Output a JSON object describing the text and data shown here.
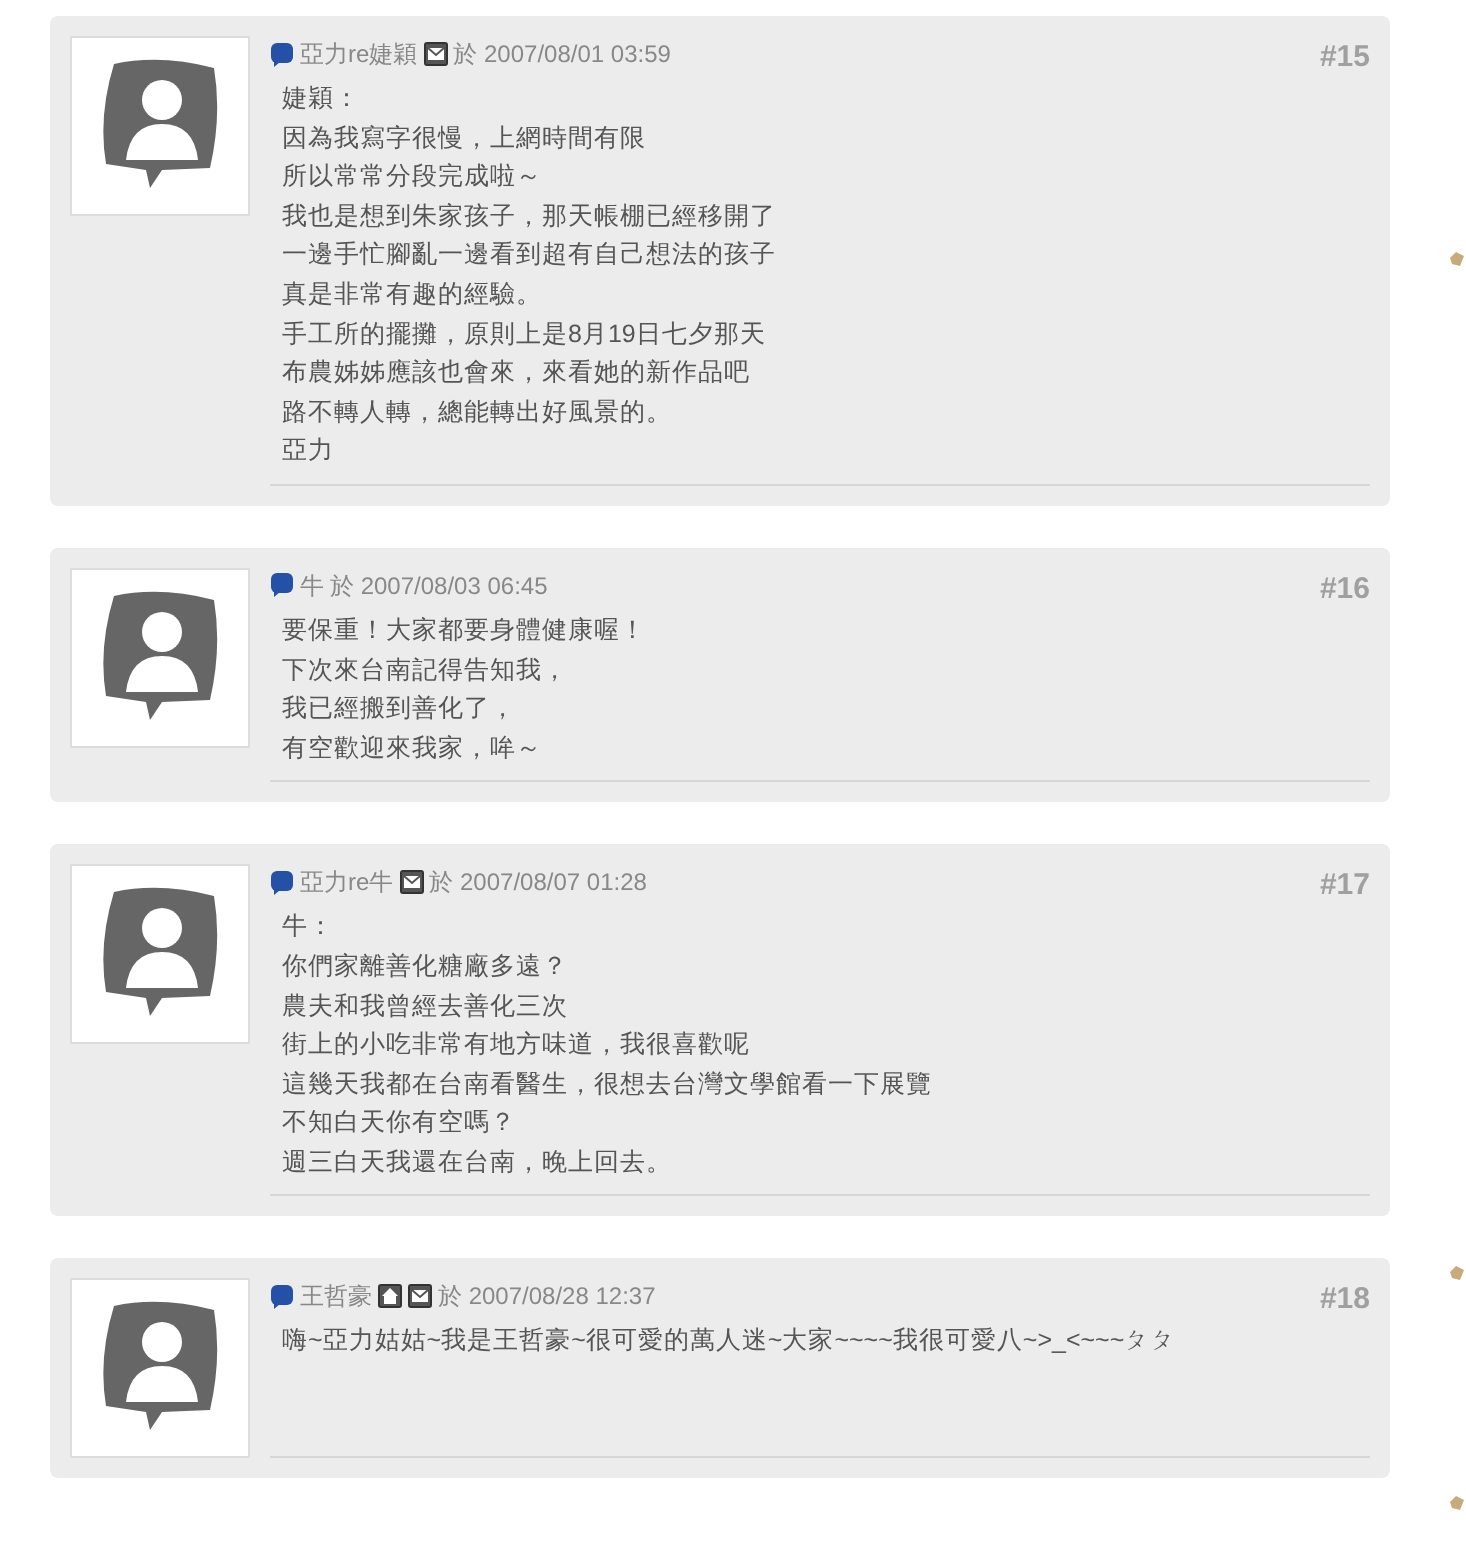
{
  "posts": [
    {
      "author": "亞力re婕穎",
      "home_link": false,
      "mail_link": true,
      "date": "於 2007/08/01 03:59",
      "number": "#15",
      "lines": [
        "婕穎：",
        "因為我寫字很慢，上網時間有限",
        "所以常常分段完成啦～",
        "我也是想到朱家孩子，那天帳棚已經移開了",
        "一邊手忙腳亂一邊看到超有自己想法的孩子",
        "真是非常有趣的經驗。",
        "手工所的擺攤，原則上是8月19日七夕那天",
        "布農姊姊應該也會來，來看她的新作品吧",
        "路不轉人轉，總能轉出好風景的。",
        "亞力"
      ]
    },
    {
      "author": "牛",
      "home_link": false,
      "mail_link": false,
      "date": "於 2007/08/03 06:45",
      "number": "#16",
      "lines": [
        "要保重！大家都要身體健康喔！",
        "下次來台南記得告知我，",
        "我已經搬到善化了，",
        "有空歡迎來我家，哞～"
      ]
    },
    {
      "author": "亞力re牛",
      "home_link": false,
      "mail_link": true,
      "date": "於 2007/08/07 01:28",
      "number": "#17",
      "lines": [
        "牛：",
        "你們家離善化糖廠多遠？",
        "農夫和我曾經去善化三次",
        "街上的小吃非常有地方味道，我很喜歡呢",
        "這幾天我都在台南看醫生，很想去台灣文學館看一下展覽",
        "不知白天你有空嗎？",
        "週三白天我還在台南，晚上回去。"
      ]
    },
    {
      "author": "王哲豪",
      "home_link": true,
      "mail_link": true,
      "date": "於 2007/08/28 12:37",
      "number": "#18",
      "lines": [
        "嗨~亞力姑姑~我是王哲豪~很可愛的萬人迷~大家~~~~我很可愛八~>_<~~~ㄆㄆ"
      ]
    }
  ]
}
